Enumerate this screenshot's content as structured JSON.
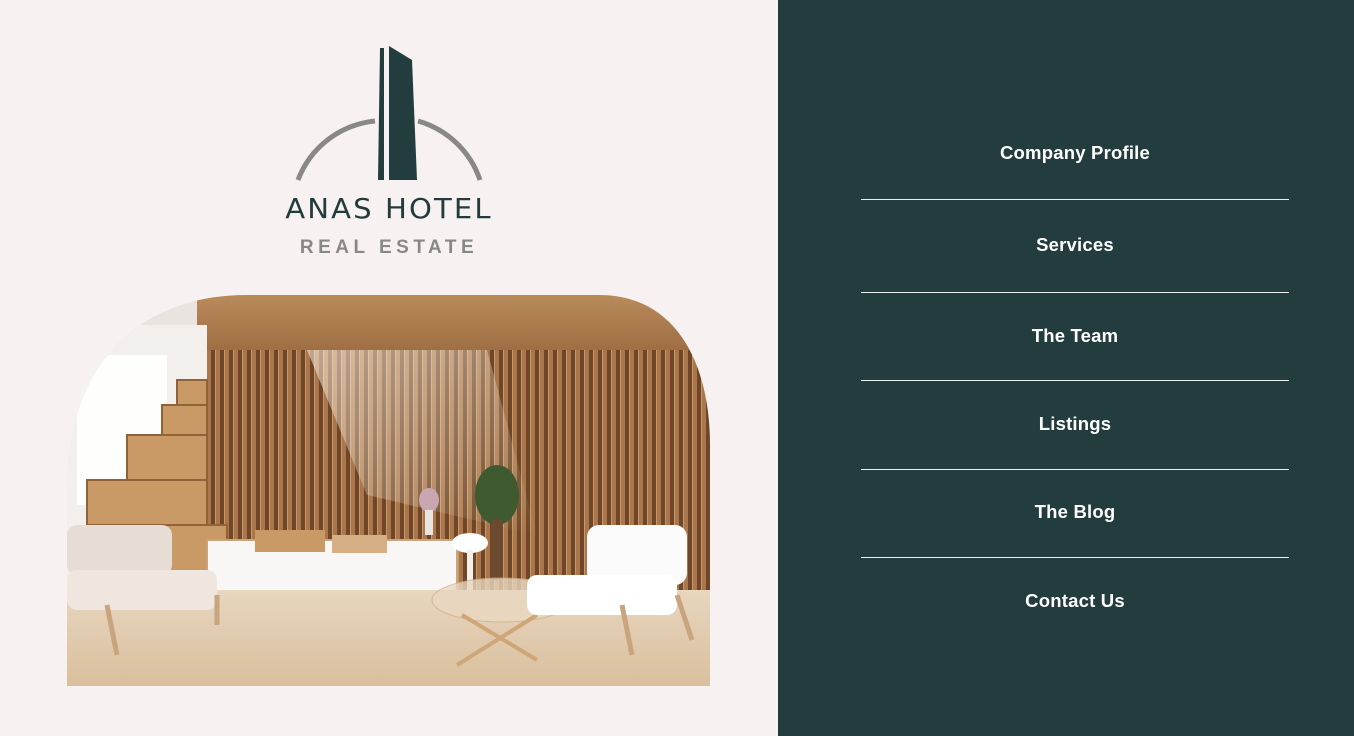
{
  "brand": {
    "name": "ANAS HOTEL",
    "tagline": "REAL ESTATE",
    "colors": {
      "dark_green": "#233c3d",
      "gray": "#8a8885",
      "background": "#f7f2f1"
    }
  },
  "hero": {
    "image": "living-room-interior"
  },
  "nav": {
    "items": [
      {
        "label": "Company Profile"
      },
      {
        "label": "Services"
      },
      {
        "label": "The Team"
      },
      {
        "label": "Listings"
      },
      {
        "label": "The Blog"
      },
      {
        "label": "Contact Us"
      }
    ]
  }
}
